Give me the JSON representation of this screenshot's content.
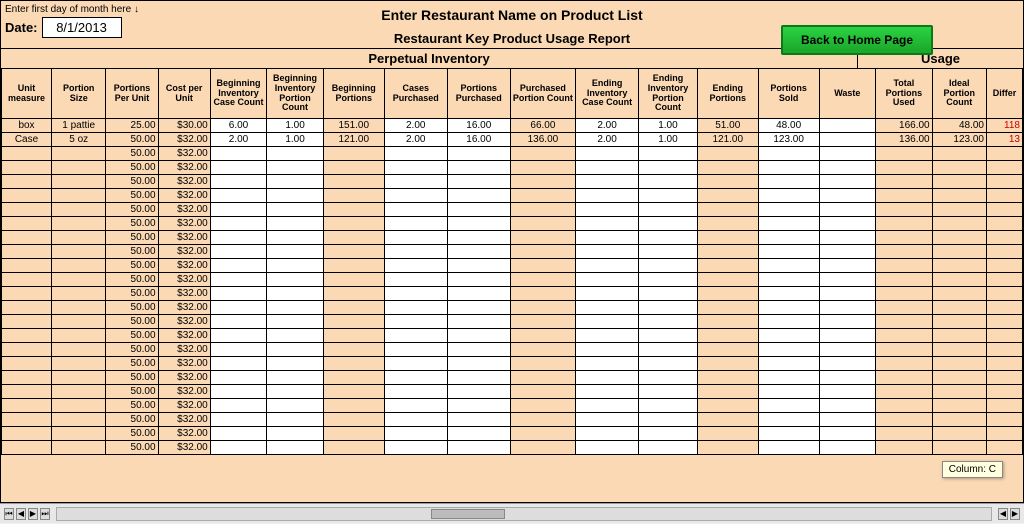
{
  "header": {
    "hint": "Enter first day of month here ↓",
    "date_label": "Date:",
    "date_value": "8/1/2013",
    "title1": "Enter Restaurant Name on Product List",
    "title2": "Restaurant Key Product Usage Report",
    "home_btn": "Back to Home Page",
    "section_perpetual": "Perpetual Inventory",
    "section_usage": "Usage"
  },
  "columns": [
    "Unit measure",
    "Portion Size",
    "Portions Per Unit",
    "Cost per Unit",
    "Beginning Inventory Case Count",
    "Beginning Inventory Portion Count",
    "Beginning Portions",
    "Cases Purchased",
    "Portions Purchased",
    "Purchased Portion Count",
    "Ending Inventory Case Count",
    "Ending Inventory Portion Count",
    "Ending Portions",
    "Portions Sold",
    "Waste",
    "Total Portions Used",
    "Ideal Portion Count",
    "Differ"
  ],
  "rows": [
    {
      "unit": "box",
      "psize": "1 pattie",
      "ppu": "25.00",
      "cpu": "$30.00",
      "bic": "6.00",
      "bip": "1.00",
      "bp": "151.00",
      "cp": "2.00",
      "pp": "16.00",
      "ppc": "66.00",
      "eic": "2.00",
      "eip": "1.00",
      "ep": "51.00",
      "ps": "48.00",
      "w": "",
      "tpu": "166.00",
      "ipc": "48.00",
      "diff": "118"
    },
    {
      "unit": "Case",
      "psize": "5 oz",
      "ppu": "50.00",
      "cpu": "$32.00",
      "bic": "2.00",
      "bip": "1.00",
      "bp": "121.00",
      "cp": "2.00",
      "pp": "16.00",
      "ppc": "136.00",
      "eic": "2.00",
      "eip": "1.00",
      "ep": "121.00",
      "ps": "123.00",
      "w": "",
      "tpu": "136.00",
      "ipc": "123.00",
      "diff": "13"
    },
    {
      "unit": "",
      "psize": "",
      "ppu": "50.00",
      "cpu": "$32.00"
    },
    {
      "unit": "",
      "psize": "",
      "ppu": "50.00",
      "cpu": "$32.00"
    },
    {
      "unit": "",
      "psize": "",
      "ppu": "50.00",
      "cpu": "$32.00"
    },
    {
      "unit": "",
      "psize": "",
      "ppu": "50.00",
      "cpu": "$32.00"
    },
    {
      "unit": "",
      "psize": "",
      "ppu": "50.00",
      "cpu": "$32.00"
    },
    {
      "unit": "",
      "psize": "",
      "ppu": "50.00",
      "cpu": "$32.00"
    },
    {
      "unit": "",
      "psize": "",
      "ppu": "50.00",
      "cpu": "$32.00"
    },
    {
      "unit": "",
      "psize": "",
      "ppu": "50.00",
      "cpu": "$32.00"
    },
    {
      "unit": "",
      "psize": "",
      "ppu": "50.00",
      "cpu": "$32.00"
    },
    {
      "unit": "",
      "psize": "",
      "ppu": "50.00",
      "cpu": "$32.00"
    },
    {
      "unit": "",
      "psize": "",
      "ppu": "50.00",
      "cpu": "$32.00"
    },
    {
      "unit": "",
      "psize": "",
      "ppu": "50.00",
      "cpu": "$32.00"
    },
    {
      "unit": "",
      "psize": "",
      "ppu": "50.00",
      "cpu": "$32.00"
    },
    {
      "unit": "",
      "psize": "",
      "ppu": "50.00",
      "cpu": "$32.00"
    },
    {
      "unit": "",
      "psize": "",
      "ppu": "50.00",
      "cpu": "$32.00"
    },
    {
      "unit": "",
      "psize": "",
      "ppu": "50.00",
      "cpu": "$32.00"
    },
    {
      "unit": "",
      "psize": "",
      "ppu": "50.00",
      "cpu": "$32.00"
    },
    {
      "unit": "",
      "psize": "",
      "ppu": "50.00",
      "cpu": "$32.00"
    },
    {
      "unit": "",
      "psize": "",
      "ppu": "50.00",
      "cpu": "$32.00"
    },
    {
      "unit": "",
      "psize": "",
      "ppu": "50.00",
      "cpu": "$32.00"
    },
    {
      "unit": "",
      "psize": "",
      "ppu": "50.00",
      "cpu": "$32.00"
    },
    {
      "unit": "",
      "psize": "",
      "ppu": "50.00",
      "cpu": "$32.00"
    }
  ],
  "status_tip": "Column: C",
  "nav": {
    "first": "⏮",
    "prev": "◀",
    "next": "▶",
    "last": "⏭"
  }
}
